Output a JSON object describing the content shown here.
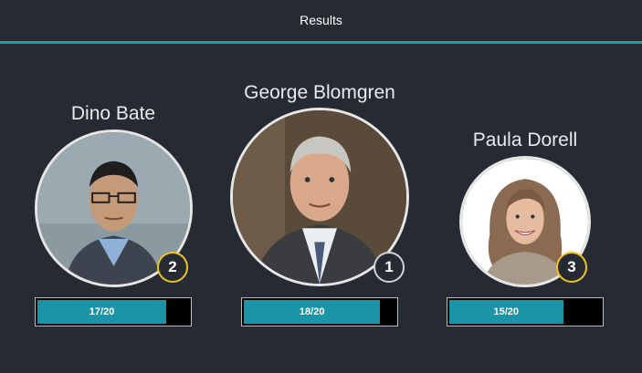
{
  "header": {
    "title": "Results"
  },
  "accent_color": "#1f9bb0",
  "contestants": [
    {
      "name": "Dino Bate",
      "rank": "2",
      "score_label": "17/20",
      "score_fraction": 0.85
    },
    {
      "name": "George Blomgren",
      "rank": "1",
      "score_label": "18/20",
      "score_fraction": 0.9
    },
    {
      "name": "Paula Dorell",
      "rank": "3",
      "score_label": "15/20",
      "score_fraction": 0.75
    }
  ]
}
